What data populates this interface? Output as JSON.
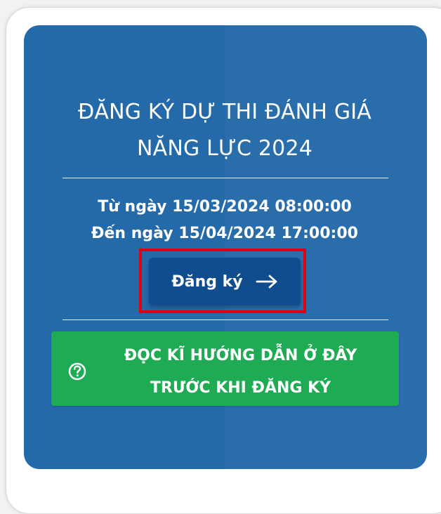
{
  "card": {
    "title_line1": "ĐĂNG KÝ DỰ THI ĐÁNH GIÁ",
    "title_line2": "NĂNG LỰC 2024",
    "date_from": "Từ ngày 15/03/2024 08:00:00",
    "date_to": "Đến ngày 15/04/2024 17:00:00",
    "register_label": "Đăng ký",
    "guide_line1": "ĐỌC KĨ HƯỚNG DẪN Ở ĐÂY",
    "guide_line2": "TRƯỚC KHI ĐĂNG KÝ"
  },
  "icons": {
    "register": "arrow-right-icon",
    "guide": "question-circle-icon"
  },
  "colors": {
    "card_bg": "#2469a8",
    "register_bg": "#0f4d8f",
    "guide_bg": "#1fab54",
    "highlight": "#e1000f"
  }
}
